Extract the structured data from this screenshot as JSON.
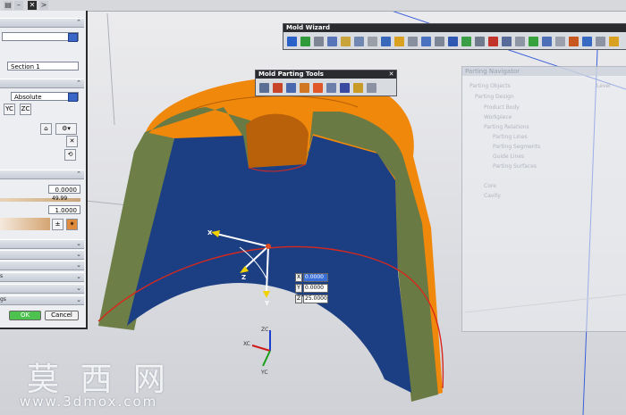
{
  "topbar": {
    "close_glyph": "✕",
    "arrow_glyph": ">"
  },
  "dialog": {
    "section_name": "Section 1",
    "csys_option": "Absolute",
    "value_a": "0.0000",
    "value_b": "49.99",
    "value_c": "1.0000",
    "ok_label": "OK",
    "cancel_label": "Cancel",
    "partial_s": "s",
    "partial_gs": "gs"
  },
  "mold_wizard": {
    "title": "Mold Wizard"
  },
  "mold_parting_tools": {
    "title": "Mold Parting Tools",
    "close": "✕"
  },
  "parting_navigator": {
    "title": "Parting Navigator",
    "col_objects": "Parting Objects",
    "col_level": "Level",
    "rows": [
      "Parting Design",
      "Product Body",
      "Workpiece",
      "Parting Relations",
      "Parting Lines",
      "Parting Segments",
      "Guide Lines",
      "Parting Surfaces",
      "Core",
      "Cavity"
    ]
  },
  "coord_inputs": [
    {
      "axis": "X",
      "value": "0.0000"
    },
    {
      "axis": "Y",
      "value": "0.0000"
    },
    {
      "axis": "Z",
      "value": "25.0000"
    }
  ],
  "triad_labels": {
    "x": "X",
    "y": "Y",
    "z": "Z"
  },
  "wcs_labels": {
    "xc": "XC",
    "yc": "YC",
    "zc": "ZC"
  },
  "watermark": {
    "chinese": "莫 西 网",
    "url": "www.3dmox.com"
  },
  "colors": {
    "cavity_orange": "#f08a10",
    "side_green": "#6a7a45",
    "inner_blue": "#1c3f84",
    "rim_red": "#d8281c"
  }
}
